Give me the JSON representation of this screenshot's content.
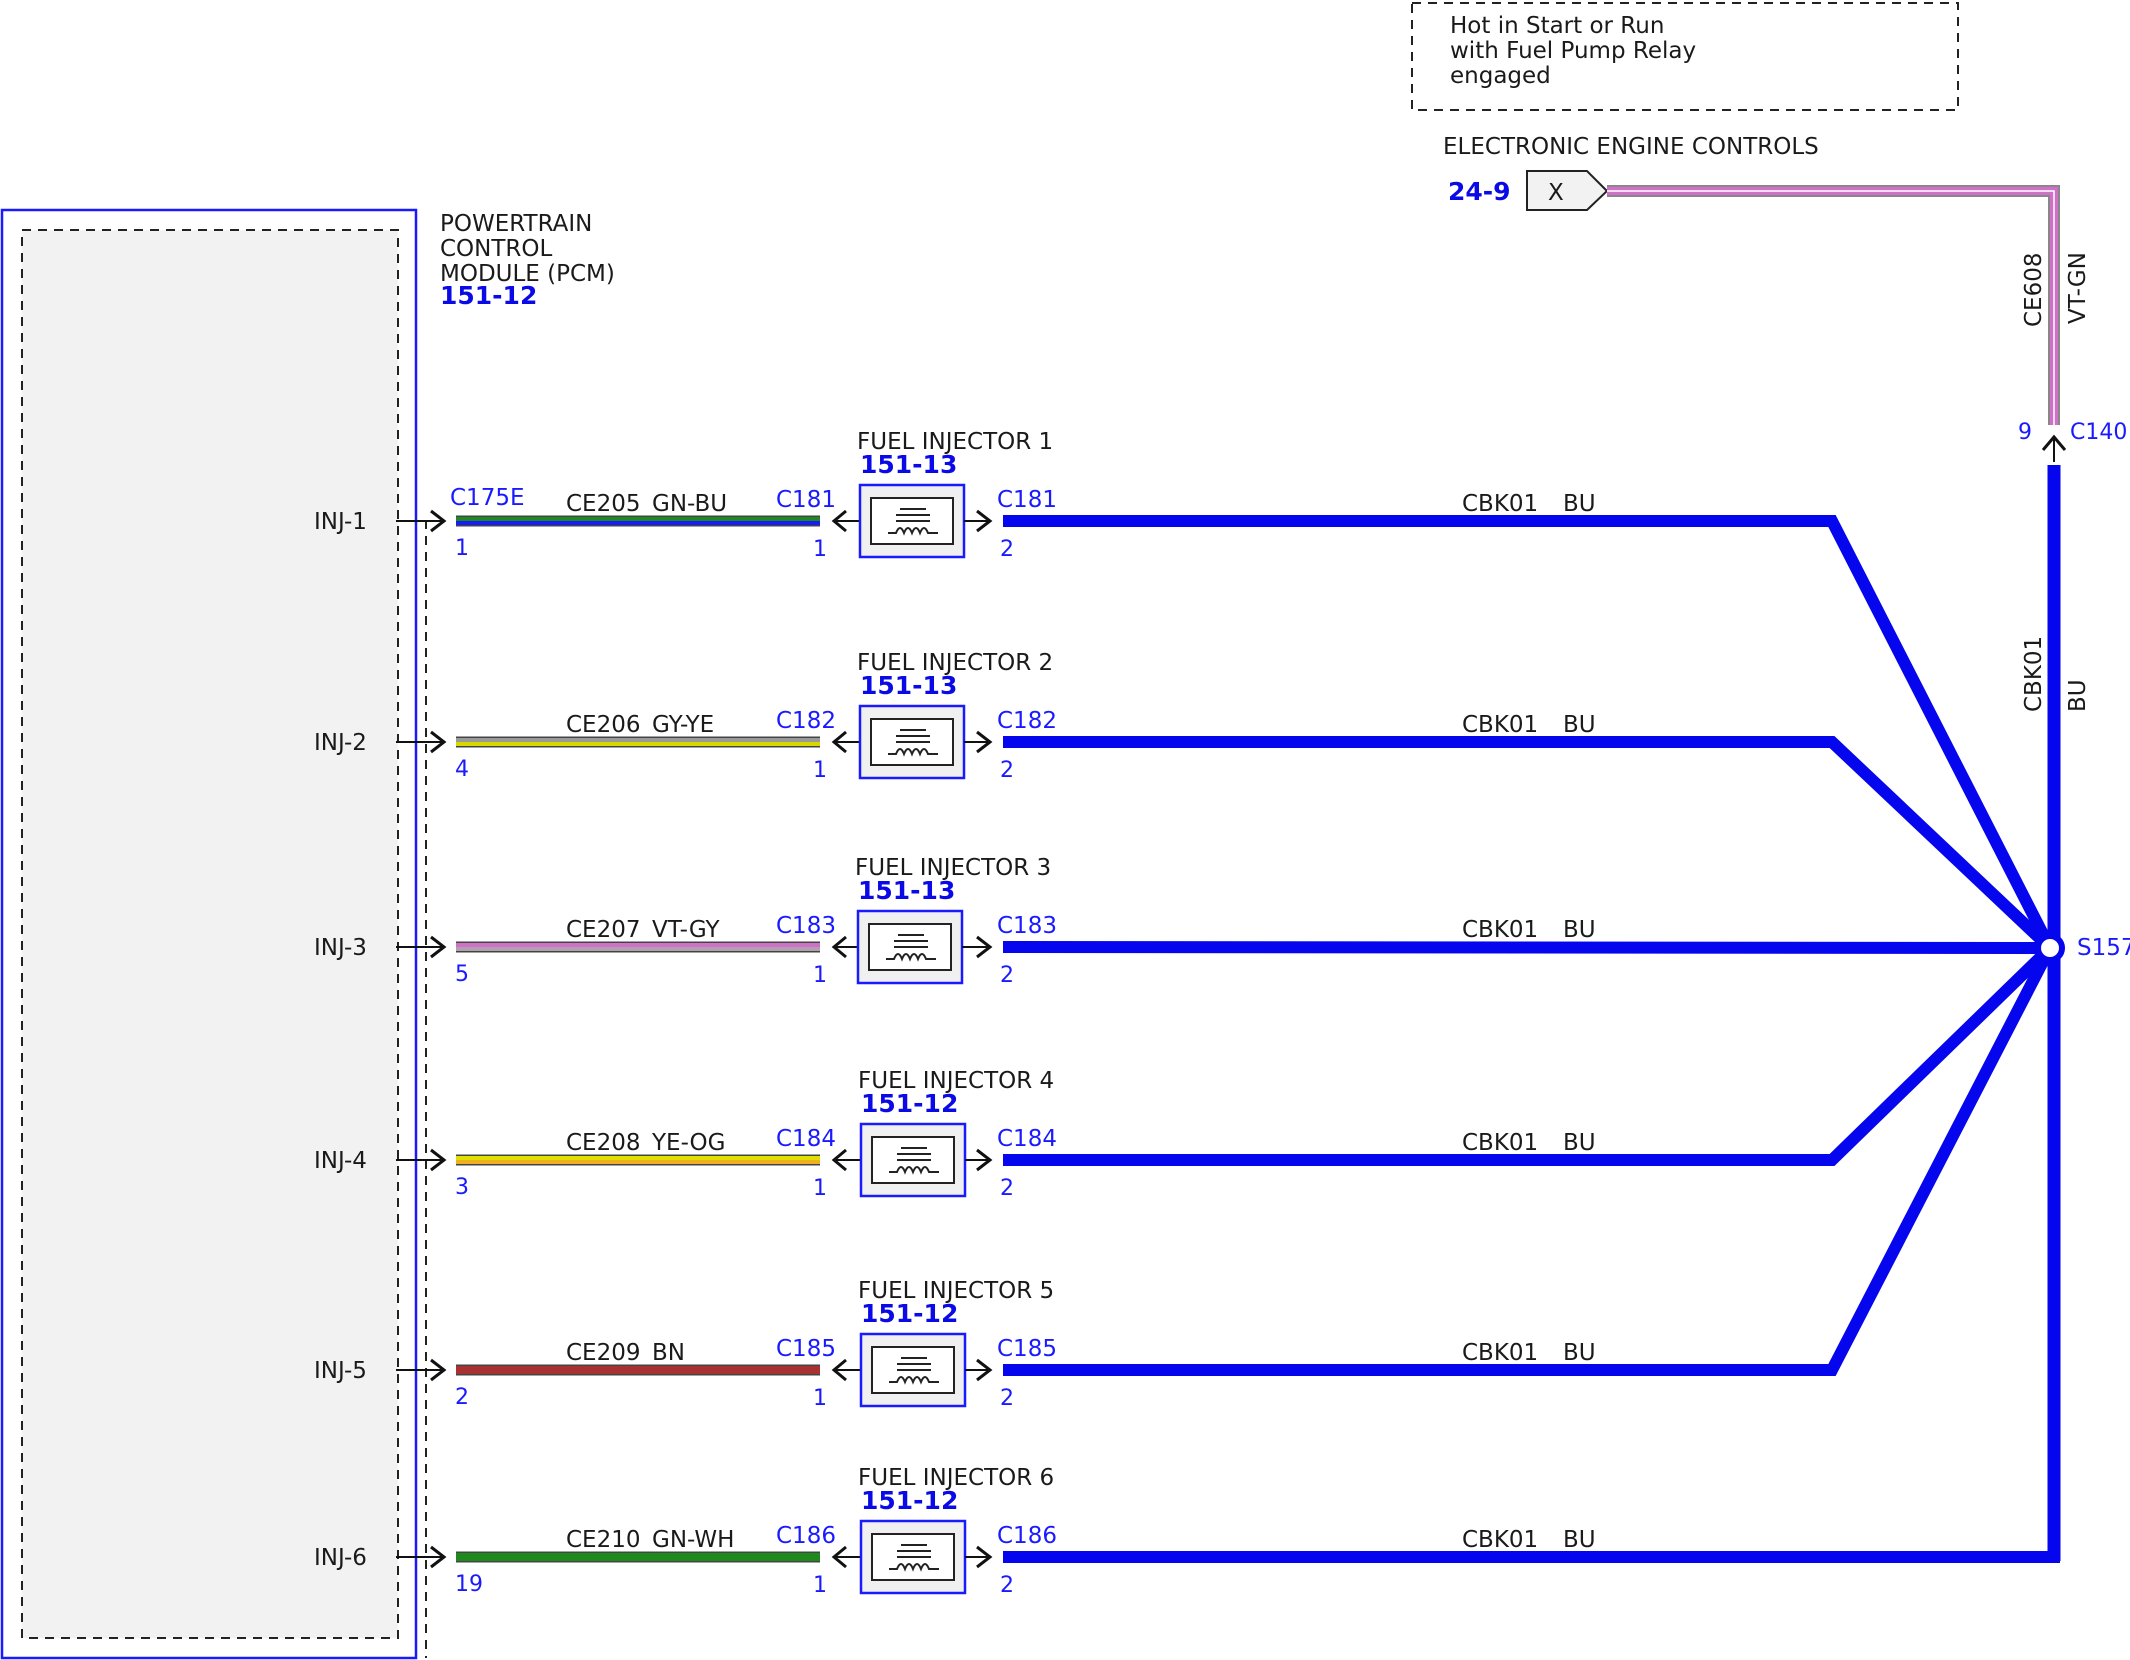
{
  "note": {
    "lines": [
      "Hot in Start or Run",
      "with Fuel Pump Relay",
      "engaged"
    ]
  },
  "feed": {
    "system_label": "ELECTRONIC ENGINE CONTROLS",
    "page_ref": "24-9",
    "connector_letter": "X",
    "circuit": "CE608",
    "color": "VT-GN",
    "connector": "C140",
    "pin": "9"
  },
  "pcm": {
    "name_lines": [
      "POWERTRAIN",
      "CONTROL",
      "MODULE (PCM)"
    ],
    "ref": "151-12",
    "connector": "C175E"
  },
  "splice": {
    "name": "S157",
    "circuit": "CBK01",
    "color": "BU"
  },
  "injectors": [
    {
      "pcm_pin_name": "INJ-1",
      "pcm_pin": "1",
      "circuit": "CE205",
      "color": "GN-BU",
      "connector": "C181",
      "title": "FUEL INJECTOR 1",
      "ref": "151-13",
      "pin_in": "1",
      "pin_out": "2",
      "return_circuit": "CBK01",
      "return_color": "BU"
    },
    {
      "pcm_pin_name": "INJ-2",
      "pcm_pin": "4",
      "circuit": "CE206",
      "color": "GY-YE",
      "connector": "C182",
      "title": "FUEL INJECTOR 2",
      "ref": "151-13",
      "pin_in": "1",
      "pin_out": "2",
      "return_circuit": "CBK01",
      "return_color": "BU"
    },
    {
      "pcm_pin_name": "INJ-3",
      "pcm_pin": "5",
      "circuit": "CE207",
      "color": "VT-GY",
      "connector": "C183",
      "title": "FUEL INJECTOR 3",
      "ref": "151-13",
      "pin_in": "1",
      "pin_out": "2",
      "return_circuit": "CBK01",
      "return_color": "BU"
    },
    {
      "pcm_pin_name": "INJ-4",
      "pcm_pin": "3",
      "circuit": "CE208",
      "color": "YE-OG",
      "connector": "C184",
      "title": "FUEL INJECTOR 4",
      "ref": "151-12",
      "pin_in": "1",
      "pin_out": "2",
      "return_circuit": "CBK01",
      "return_color": "BU"
    },
    {
      "pcm_pin_name": "INJ-5",
      "pcm_pin": "2",
      "circuit": "CE209",
      "color": "BN",
      "connector": "C185",
      "title": "FUEL INJECTOR 5",
      "ref": "151-12",
      "pin_in": "1",
      "pin_out": "2",
      "return_circuit": "CBK01",
      "return_color": "BU"
    },
    {
      "pcm_pin_name": "INJ-6",
      "pcm_pin": "19",
      "circuit": "CE210",
      "color": "GN-WH",
      "connector": "C186",
      "title": "FUEL INJECTOR 6",
      "ref": "151-12",
      "pin_in": "1",
      "pin_out": "2",
      "return_circuit": "CBK01",
      "return_color": "BU"
    }
  ],
  "wire_colors": {
    "GN-BU": [
      "#1e8a1e",
      "#1a1aff"
    ],
    "GY-YE": [
      "#9a9a9a",
      "#d8d800"
    ],
    "VT-GY": [
      "#d070c8",
      "#b0a0b0"
    ],
    "YE-OG": [
      "#e0e000",
      "#f0b020"
    ],
    "BN": [
      "#a83232",
      "#a83232"
    ],
    "GN-WH": [
      "#1e8a1e",
      "#1e8a1e"
    ],
    "VT-GN": [
      "#d070c8",
      "#c080c0"
    ],
    "BU": [
      "#0505ee",
      "#0505ee"
    ]
  }
}
